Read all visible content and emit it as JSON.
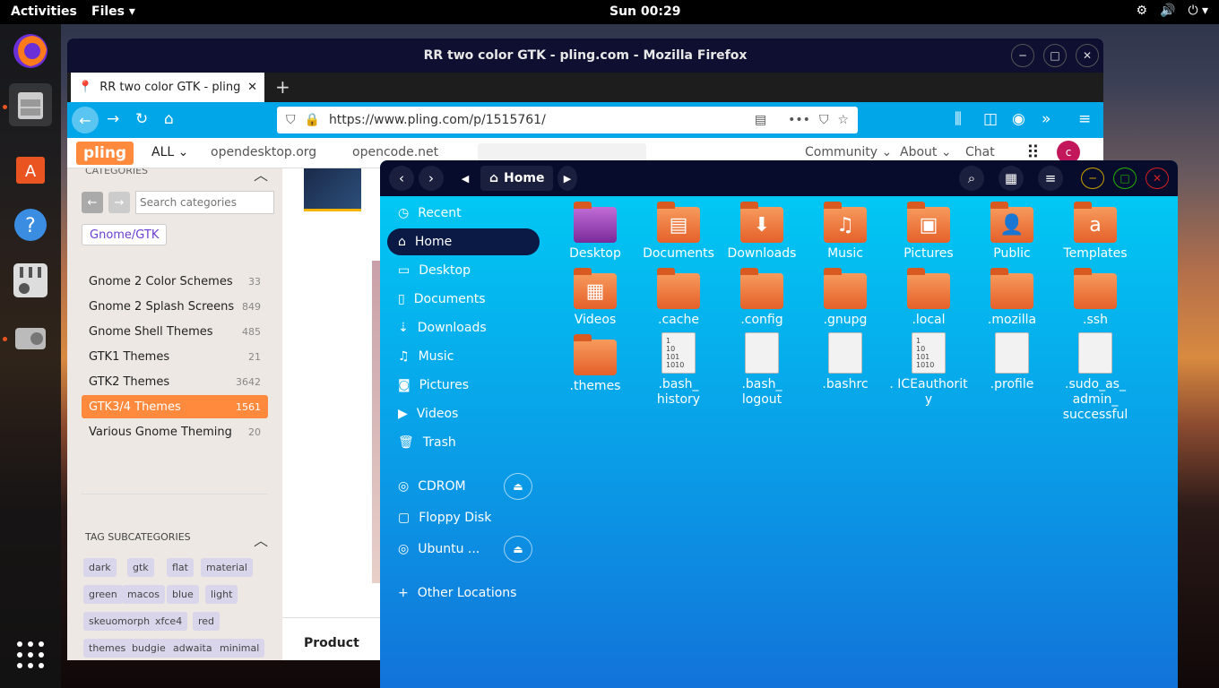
{
  "topbar": {
    "activities": "Activities",
    "app_menu": "Files ▾",
    "clock": "Sun 00:29",
    "tray": [
      "⚙",
      "🔊",
      "⏻ ▾"
    ]
  },
  "firefox": {
    "title": "RR two color GTK - pling.com - Mozilla Firefox",
    "tab_title": "RR two color GTK - pling",
    "url_host": "https://www.pling.com/p/1515761/",
    "site": {
      "logo": "pling",
      "all": "ALL ⌄",
      "links": [
        "opendesktop.org",
        "opencode.net"
      ],
      "community": "Community ⌄",
      "about": "About ⌄",
      "chat": "Chat",
      "avatar": "c"
    },
    "sidebar": {
      "categories_header": "CATEGORIES",
      "search_placeholder": "Search categories",
      "crumb": "Gnome/GTK",
      "items": [
        {
          "label": "Gnome 2 Color Schemes",
          "count": "33"
        },
        {
          "label": "Gnome 2 Splash Screens",
          "count": "849"
        },
        {
          "label": "Gnome Shell Themes",
          "count": "485"
        },
        {
          "label": "GTK1 Themes",
          "count": "21"
        },
        {
          "label": "GTK2 Themes",
          "count": "3642"
        },
        {
          "label": "GTK3/4 Themes",
          "count": "1561"
        },
        {
          "label": "Various Gnome Theming",
          "count": "20"
        }
      ],
      "tag_header": "TAG SUBCATEGORIES",
      "tags": [
        "dark",
        "gtk",
        "flat",
        "material",
        "green",
        "macos",
        "blue",
        "light",
        "skeuomorph",
        "xfce4",
        "red",
        "themes",
        "budgie",
        "adwaita",
        "minimal"
      ]
    },
    "product_label": "Product"
  },
  "nautilus": {
    "path": "Home",
    "sidebar": [
      "Recent",
      "Home",
      "Desktop",
      "Documents",
      "Downloads",
      "Music",
      "Pictures",
      "Videos",
      "Trash"
    ],
    "devices": [
      "CDROM",
      "Floppy Disk",
      "Ubuntu ..."
    ],
    "other": "Other Locations",
    "files": [
      {
        "name": "Desktop",
        "kind": "folder",
        "glyph": ""
      },
      {
        "name": "Documents",
        "kind": "folder",
        "glyph": "▤"
      },
      {
        "name": "Downloads",
        "kind": "folder",
        "glyph": "⬇"
      },
      {
        "name": "Music",
        "kind": "folder",
        "glyph": "♫"
      },
      {
        "name": "Pictures",
        "kind": "folder",
        "glyph": "▣"
      },
      {
        "name": "Public",
        "kind": "folder",
        "glyph": "👤"
      },
      {
        "name": "Templates",
        "kind": "folder",
        "glyph": "a"
      },
      {
        "name": "Videos",
        "kind": "folder",
        "glyph": "▦"
      },
      {
        "name": ".cache",
        "kind": "folder",
        "glyph": ""
      },
      {
        "name": ".config",
        "kind": "folder",
        "glyph": ""
      },
      {
        "name": ".gnupg",
        "kind": "folder",
        "glyph": ""
      },
      {
        "name": ".local",
        "kind": "folder",
        "glyph": ""
      },
      {
        "name": ".mozilla",
        "kind": "folder",
        "glyph": ""
      },
      {
        "name": ".ssh",
        "kind": "folder",
        "glyph": ""
      },
      {
        "name": ".themes",
        "kind": "folder",
        "glyph": ""
      },
      {
        "name": ".bash_ history",
        "kind": "doc",
        "glyph": "1\n10\n101\n1010"
      },
      {
        "name": ".bash_ logout",
        "kind": "doc",
        "glyph": ""
      },
      {
        "name": ".bashrc",
        "kind": "doc",
        "glyph": ""
      },
      {
        "name": ". ICEauthorit y",
        "kind": "doc",
        "glyph": "1\n10\n101\n1010"
      },
      {
        "name": ".profile",
        "kind": "doc",
        "glyph": ""
      },
      {
        "name": ".sudo_as_ admin_ successful",
        "kind": "doc",
        "glyph": ""
      }
    ]
  }
}
